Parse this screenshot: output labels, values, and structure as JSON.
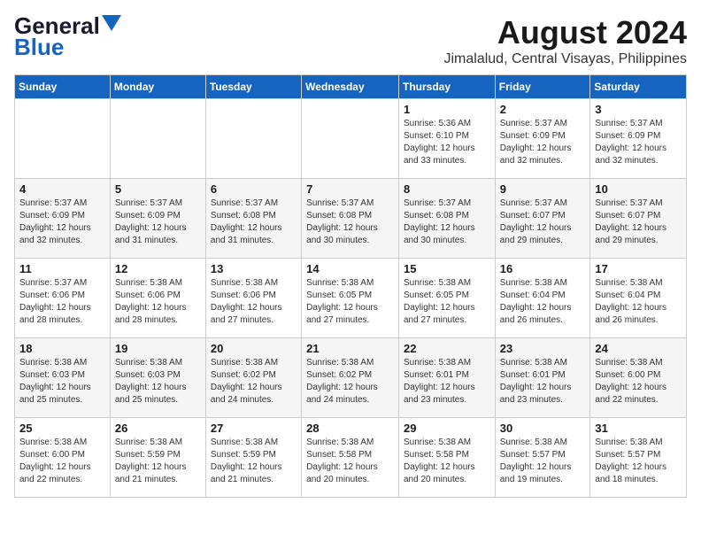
{
  "header": {
    "logo_line1": "General",
    "logo_line2": "Blue",
    "title": "August 2024",
    "subtitle": "Jimalalud, Central Visayas, Philippines"
  },
  "days_of_week": [
    "Sunday",
    "Monday",
    "Tuesday",
    "Wednesday",
    "Thursday",
    "Friday",
    "Saturday"
  ],
  "weeks": [
    [
      {
        "day": "",
        "info": ""
      },
      {
        "day": "",
        "info": ""
      },
      {
        "day": "",
        "info": ""
      },
      {
        "day": "",
        "info": ""
      },
      {
        "day": "1",
        "info": "Sunrise: 5:36 AM\nSunset: 6:10 PM\nDaylight: 12 hours\nand 33 minutes."
      },
      {
        "day": "2",
        "info": "Sunrise: 5:37 AM\nSunset: 6:09 PM\nDaylight: 12 hours\nand 32 minutes."
      },
      {
        "day": "3",
        "info": "Sunrise: 5:37 AM\nSunset: 6:09 PM\nDaylight: 12 hours\nand 32 minutes."
      }
    ],
    [
      {
        "day": "4",
        "info": "Sunrise: 5:37 AM\nSunset: 6:09 PM\nDaylight: 12 hours\nand 32 minutes."
      },
      {
        "day": "5",
        "info": "Sunrise: 5:37 AM\nSunset: 6:09 PM\nDaylight: 12 hours\nand 31 minutes."
      },
      {
        "day": "6",
        "info": "Sunrise: 5:37 AM\nSunset: 6:08 PM\nDaylight: 12 hours\nand 31 minutes."
      },
      {
        "day": "7",
        "info": "Sunrise: 5:37 AM\nSunset: 6:08 PM\nDaylight: 12 hours\nand 30 minutes."
      },
      {
        "day": "8",
        "info": "Sunrise: 5:37 AM\nSunset: 6:08 PM\nDaylight: 12 hours\nand 30 minutes."
      },
      {
        "day": "9",
        "info": "Sunrise: 5:37 AM\nSunset: 6:07 PM\nDaylight: 12 hours\nand 29 minutes."
      },
      {
        "day": "10",
        "info": "Sunrise: 5:37 AM\nSunset: 6:07 PM\nDaylight: 12 hours\nand 29 minutes."
      }
    ],
    [
      {
        "day": "11",
        "info": "Sunrise: 5:37 AM\nSunset: 6:06 PM\nDaylight: 12 hours\nand 28 minutes."
      },
      {
        "day": "12",
        "info": "Sunrise: 5:38 AM\nSunset: 6:06 PM\nDaylight: 12 hours\nand 28 minutes."
      },
      {
        "day": "13",
        "info": "Sunrise: 5:38 AM\nSunset: 6:06 PM\nDaylight: 12 hours\nand 27 minutes."
      },
      {
        "day": "14",
        "info": "Sunrise: 5:38 AM\nSunset: 6:05 PM\nDaylight: 12 hours\nand 27 minutes."
      },
      {
        "day": "15",
        "info": "Sunrise: 5:38 AM\nSunset: 6:05 PM\nDaylight: 12 hours\nand 27 minutes."
      },
      {
        "day": "16",
        "info": "Sunrise: 5:38 AM\nSunset: 6:04 PM\nDaylight: 12 hours\nand 26 minutes."
      },
      {
        "day": "17",
        "info": "Sunrise: 5:38 AM\nSunset: 6:04 PM\nDaylight: 12 hours\nand 26 minutes."
      }
    ],
    [
      {
        "day": "18",
        "info": "Sunrise: 5:38 AM\nSunset: 6:03 PM\nDaylight: 12 hours\nand 25 minutes."
      },
      {
        "day": "19",
        "info": "Sunrise: 5:38 AM\nSunset: 6:03 PM\nDaylight: 12 hours\nand 25 minutes."
      },
      {
        "day": "20",
        "info": "Sunrise: 5:38 AM\nSunset: 6:02 PM\nDaylight: 12 hours\nand 24 minutes."
      },
      {
        "day": "21",
        "info": "Sunrise: 5:38 AM\nSunset: 6:02 PM\nDaylight: 12 hours\nand 24 minutes."
      },
      {
        "day": "22",
        "info": "Sunrise: 5:38 AM\nSunset: 6:01 PM\nDaylight: 12 hours\nand 23 minutes."
      },
      {
        "day": "23",
        "info": "Sunrise: 5:38 AM\nSunset: 6:01 PM\nDaylight: 12 hours\nand 23 minutes."
      },
      {
        "day": "24",
        "info": "Sunrise: 5:38 AM\nSunset: 6:00 PM\nDaylight: 12 hours\nand 22 minutes."
      }
    ],
    [
      {
        "day": "25",
        "info": "Sunrise: 5:38 AM\nSunset: 6:00 PM\nDaylight: 12 hours\nand 22 minutes."
      },
      {
        "day": "26",
        "info": "Sunrise: 5:38 AM\nSunset: 5:59 PM\nDaylight: 12 hours\nand 21 minutes."
      },
      {
        "day": "27",
        "info": "Sunrise: 5:38 AM\nSunset: 5:59 PM\nDaylight: 12 hours\nand 21 minutes."
      },
      {
        "day": "28",
        "info": "Sunrise: 5:38 AM\nSunset: 5:58 PM\nDaylight: 12 hours\nand 20 minutes."
      },
      {
        "day": "29",
        "info": "Sunrise: 5:38 AM\nSunset: 5:58 PM\nDaylight: 12 hours\nand 20 minutes."
      },
      {
        "day": "30",
        "info": "Sunrise: 5:38 AM\nSunset: 5:57 PM\nDaylight: 12 hours\nand 19 minutes."
      },
      {
        "day": "31",
        "info": "Sunrise: 5:38 AM\nSunset: 5:57 PM\nDaylight: 12 hours\nand 18 minutes."
      }
    ]
  ]
}
